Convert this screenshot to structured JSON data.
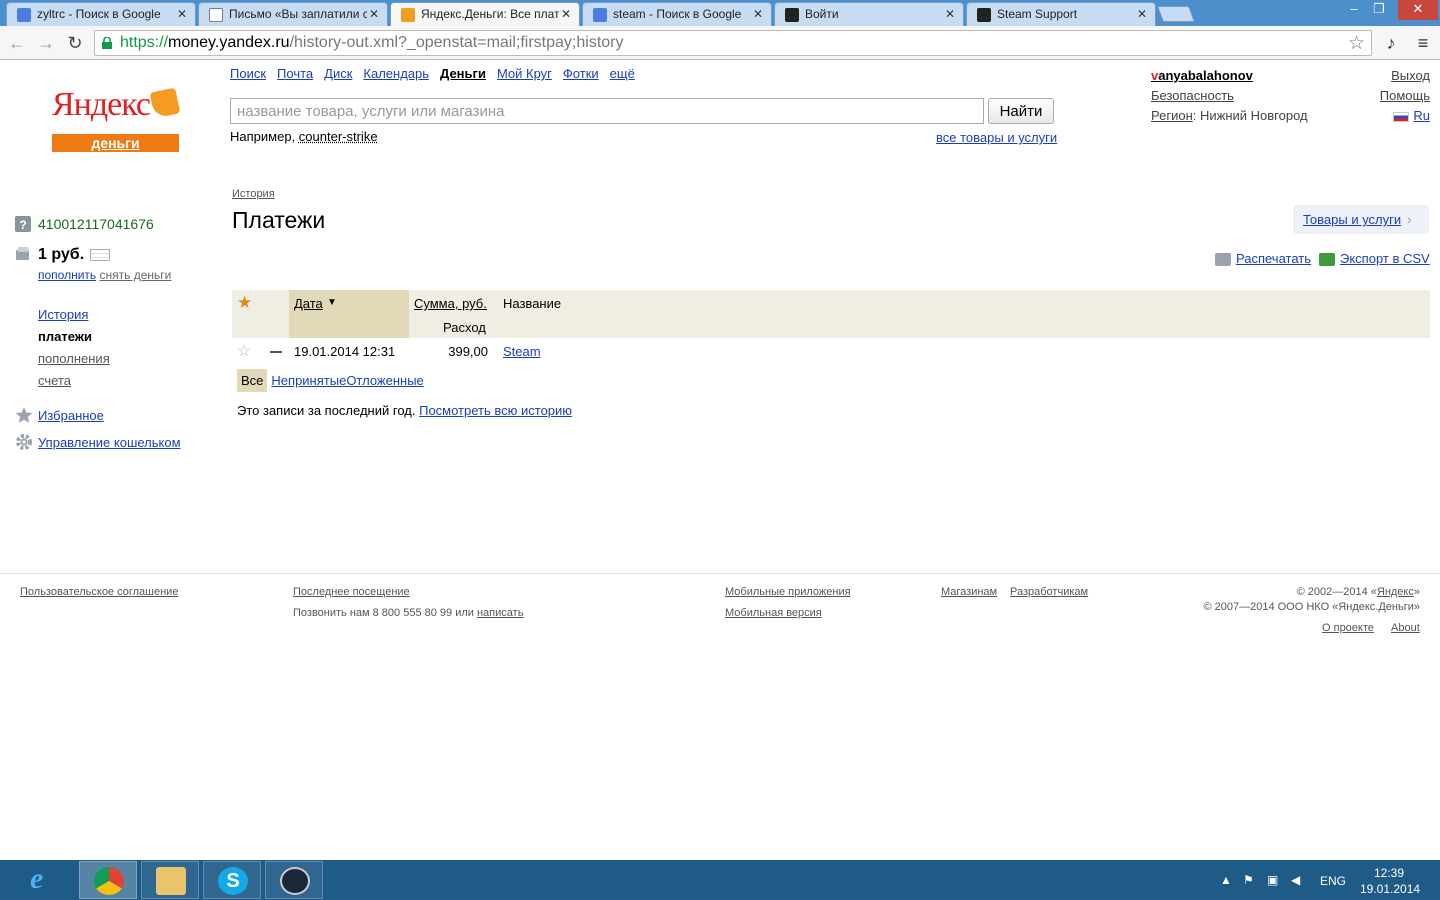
{
  "browser": {
    "tabs": [
      {
        "title": "zyltrc - Поиск в Google",
        "icon": "google-icon"
      },
      {
        "title": "Письмо «Вы заплатили с",
        "icon": "mail-icon"
      },
      {
        "title": "Яндекс.Деньги: Все плате",
        "icon": "yandex-money-icon"
      },
      {
        "title": "steam - Поиск в Google",
        "icon": "google-icon"
      },
      {
        "title": "Войти",
        "icon": "steam-icon"
      },
      {
        "title": "Steam Support",
        "icon": "steam-icon"
      }
    ],
    "url_scheme": "https://",
    "url_host": "money.yandex.ru",
    "url_path": "/history-out.xml?_openstat=mail;firstpay;history"
  },
  "header": {
    "logo_text": "Яндекс",
    "logo_sub": "деньги",
    "services": [
      "Поиск",
      "Почта",
      "Диск",
      "Календарь",
      "Деньги",
      "Мой Круг",
      "Фотки",
      "ещё"
    ],
    "search_placeholder": "название товара, услуги или магазина",
    "search_button": "Найти",
    "example_label": "Например,",
    "example_link": "counter-strike",
    "all_goods": "все товары и услуги",
    "username_first": "v",
    "username_rest": "anyabalahonov",
    "security": "Безопасность",
    "region_label": "Регион",
    "region_value": ": Нижний Новгород",
    "logout": "Выход",
    "help": "Помощь",
    "lang": "Ru"
  },
  "sidebar": {
    "account_number": "410012117041676",
    "balance": "1 руб.",
    "topup": "пополнить",
    "withdraw": "снять деньги",
    "nav": [
      "История",
      "платежи",
      "пополнения",
      "счета"
    ],
    "favorites": "Избранное",
    "wallet_management": "Управление кошельком"
  },
  "main": {
    "breadcrumb": "История",
    "title": "Платежи",
    "goods_button": "Товары и услуги",
    "print": "Распечатать",
    "export_csv": "Экспорт в CSV",
    "table": {
      "col_date": "Дата",
      "col_sum": "Сумма, руб.",
      "col_expense": "Расход",
      "col_name": "Название",
      "rows": [
        {
          "date": "19.01.2014 12:31",
          "amount": "399,00",
          "name": "Steam"
        }
      ]
    },
    "filters": [
      "Все",
      "Непринятые",
      "Отложенные"
    ],
    "note": "Это записи за последний год.",
    "note_link": "Посмотреть всю историю"
  },
  "footer": {
    "agreement": "Пользовательское соглашение",
    "last_visit": "Последнее посещение",
    "call_us": "Позвонить нам 8 800 555 80 99 или",
    "write": "написать",
    "mobile_apps": "Мобильные приложения",
    "mobile_version": "Мобильная версия",
    "shops": "Магазинам",
    "developers": "Разработчикам",
    "copyright_pre": "© 2002—2014 «",
    "copyright_link": "Яндекс",
    "copyright_post": "»",
    "copyright2": "© 2007—2014 ООО НКО «Яндекс.Деньги»",
    "about_ru": "О проекте",
    "about_en": "About"
  },
  "taskbar": {
    "lang": "ENG",
    "time": "12:39",
    "date": "19.01.2014"
  }
}
